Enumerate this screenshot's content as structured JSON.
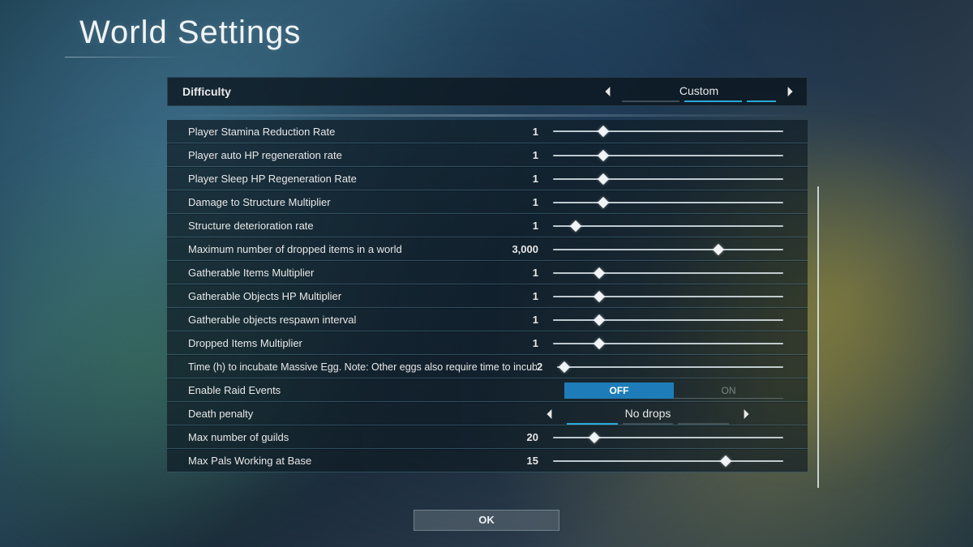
{
  "title": "World Settings",
  "difficulty": {
    "label": "Difficulty",
    "value": "Custom"
  },
  "settings": [
    {
      "label": "Player Stamina Reduction Rate",
      "value": "1",
      "type": "slider",
      "pct": 22
    },
    {
      "label": "Player auto HP regeneration rate",
      "value": "1",
      "type": "slider",
      "pct": 22
    },
    {
      "label": "Player Sleep HP Regeneration Rate",
      "value": "1",
      "type": "slider",
      "pct": 22
    },
    {
      "label": "Damage to Structure Multiplier",
      "value": "1",
      "type": "slider",
      "pct": 22
    },
    {
      "label": "Structure deterioration rate",
      "value": "1",
      "type": "slider",
      "pct": 10
    },
    {
      "label": "Maximum number of dropped items in a world",
      "value": "3,000",
      "type": "slider",
      "pct": 72
    },
    {
      "label": "Gatherable Items Multiplier",
      "value": "1",
      "type": "slider",
      "pct": 20
    },
    {
      "label": "Gatherable Objects HP Multiplier",
      "value": "1",
      "type": "slider",
      "pct": 20
    },
    {
      "label": "Gatherable objects respawn interval",
      "value": "1",
      "type": "slider",
      "pct": 20
    },
    {
      "label": "Dropped Items Multiplier",
      "value": "1",
      "type": "slider",
      "pct": 20
    },
    {
      "label": "Time (h) to incubate Massive Egg. Note: Other eggs also require time to incubate.",
      "value": "2",
      "type": "slider",
      "pct": 3,
      "long": true
    },
    {
      "label": "Enable Raid Events",
      "type": "toggle",
      "off": "OFF",
      "on": "ON",
      "selected": "off"
    },
    {
      "label": "Death penalty",
      "type": "selector",
      "value": "No drops"
    },
    {
      "label": "Max number of guilds",
      "value": "20",
      "type": "slider",
      "pct": 18
    },
    {
      "label": "Max Pals Working at Base",
      "value": "15",
      "type": "slider",
      "pct": 75
    }
  ],
  "ok": "OK"
}
